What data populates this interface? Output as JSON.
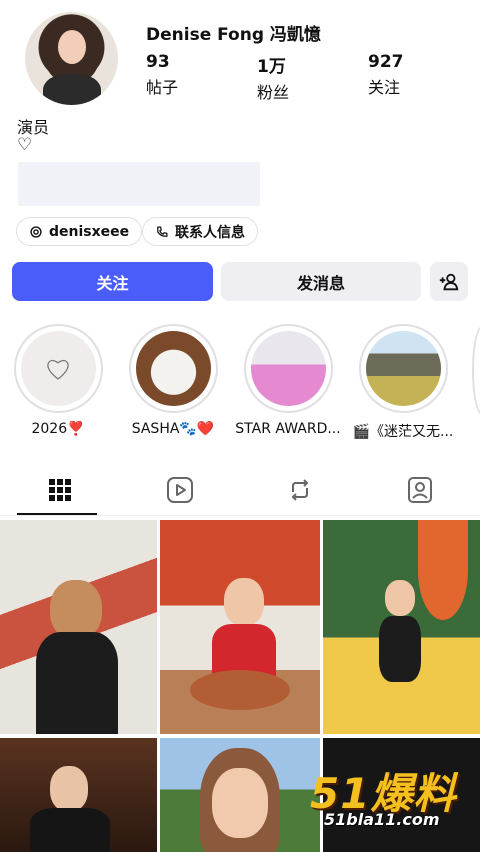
{
  "profile": {
    "name": "Denise Fong 冯凱憶",
    "stats": [
      {
        "value": "93",
        "label": "帖子"
      },
      {
        "value": "1万",
        "label": "粉丝"
      },
      {
        "value": "927",
        "label": "关注"
      }
    ],
    "bio_role": "演员",
    "bio_heart": "♡"
  },
  "chips": {
    "threads_label": "denisxeee",
    "contact_label": "联系人信息"
  },
  "actions": {
    "follow_label": "关注",
    "message_label": "发消息"
  },
  "highlights": [
    {
      "label": "2026❣️"
    },
    {
      "label": "SASHA🐾❤️"
    },
    {
      "label": "STAR AWARD..."
    },
    {
      "label": "🎬《迷茫又无..."
    }
  ],
  "tabs": [
    "grid-icon",
    "reels-icon",
    "reposts-icon",
    "tagged-icon"
  ],
  "watermark": {
    "brand": "51爆料",
    "url": "51bla11.com"
  },
  "colors": {
    "accent": "#4a5df9",
    "button_gray": "#efeff3"
  }
}
